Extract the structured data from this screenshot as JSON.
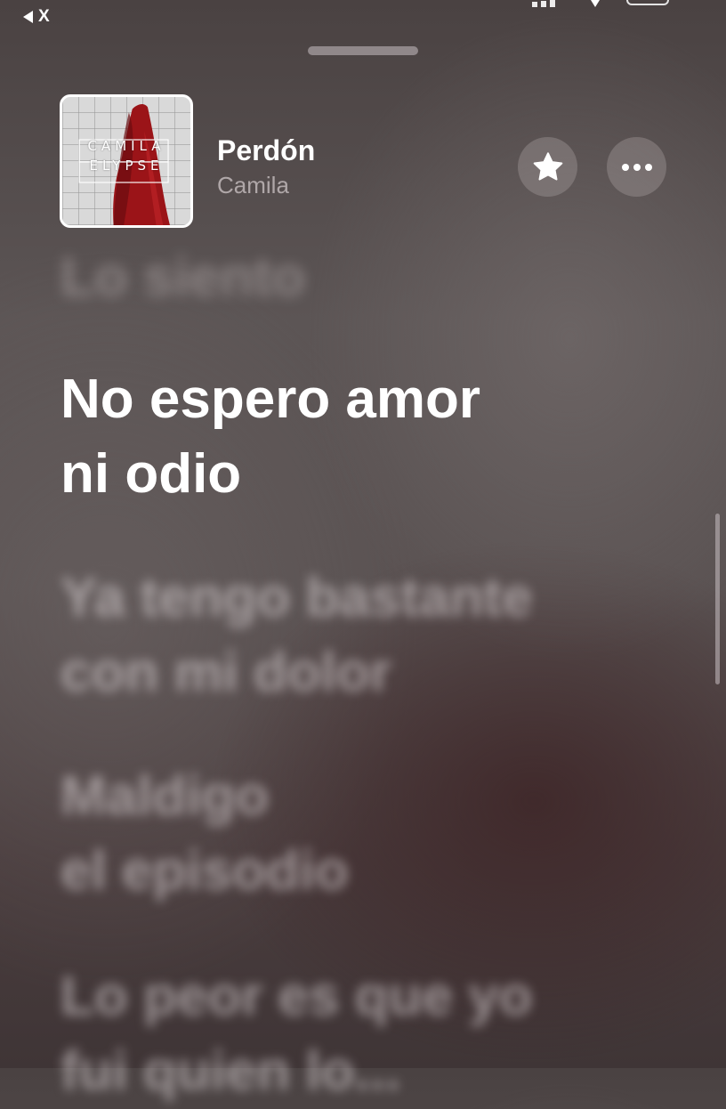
{
  "status_bar": {
    "back_label": "X",
    "signal_bars": 3
  },
  "now_playing": {
    "artwork_text_line1": "CAMILA",
    "artwork_text_line2": "ELYPSE",
    "title": "Perdón",
    "artist": "Camila"
  },
  "lyrics": {
    "previous_line": "Lo siento",
    "current_line": [
      "No espero amor",
      "ni odio"
    ],
    "upcoming": [
      [
        "Ya tengo bastante",
        "con mi dolor"
      ],
      [
        "Maldigo",
        "el episodio"
      ],
      [
        "Lo peor es que yo",
        "fui quien lo..."
      ]
    ]
  },
  "colors": {
    "text_primary": "#ffffff",
    "text_secondary": "#d2cacc",
    "artwork_red": "#9b1418"
  },
  "icons": {
    "favorite": "star-icon",
    "more": "ellipsis-icon",
    "back": "back-triangle-icon"
  }
}
